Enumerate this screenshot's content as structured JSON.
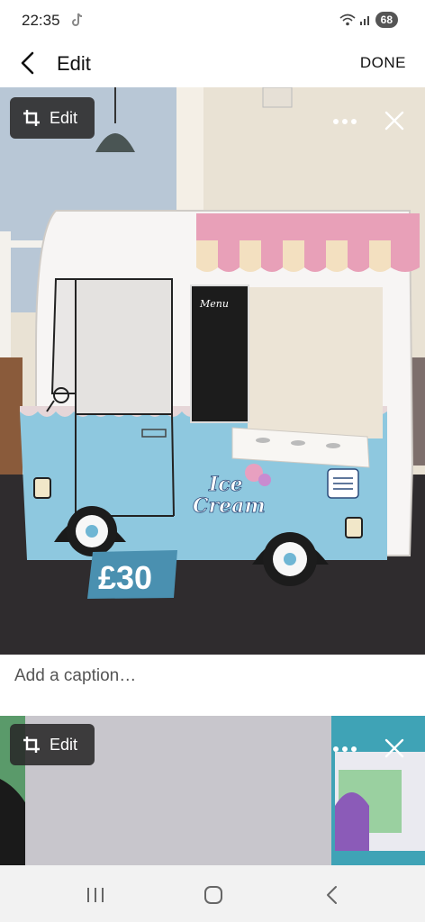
{
  "status": {
    "time": "22:35",
    "battery": "68"
  },
  "header": {
    "title": "Edit",
    "done_label": "DONE"
  },
  "photos": [
    {
      "edit_label": "Edit",
      "price_tag": "£30",
      "menu_text": "Menu",
      "logo_line1": "Ice",
      "logo_line2": "Cream"
    },
    {
      "edit_label": "Edit"
    }
  ],
  "caption": {
    "placeholder": "Add a caption…",
    "value": ""
  },
  "icons": {
    "status": [
      "tiktok-icon",
      "wifi-icon",
      "signal-icon",
      "battery-icon"
    ],
    "header": [
      "back-arrow-icon"
    ],
    "photo": [
      "crop-icon",
      "more-options-icon",
      "close-icon"
    ],
    "nav": [
      "recent-apps-icon",
      "home-icon",
      "back-icon"
    ]
  },
  "colors": {
    "header_bg": "#ffffff",
    "chip_bg": "#282828",
    "nav_bg": "#f2f2f2",
    "van_blue": "#8cc9e0",
    "awning_pink": "#e8a0b8",
    "price_tag_bg": "#4a90b0"
  }
}
